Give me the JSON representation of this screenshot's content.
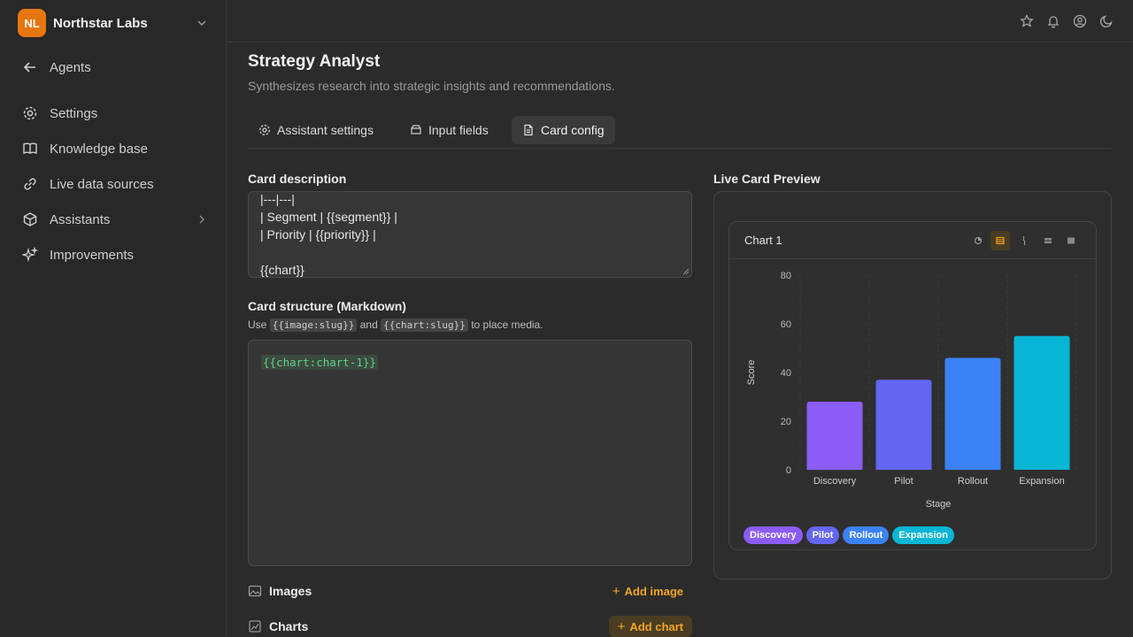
{
  "org": {
    "initials": "NL",
    "name": "Northstar Labs"
  },
  "sidebar": {
    "items": [
      {
        "label": "Agents",
        "icon": "arrow-left-icon"
      },
      {
        "label": "Settings",
        "icon": "gear-icon"
      },
      {
        "label": "Knowledge base",
        "icon": "book-icon"
      },
      {
        "label": "Live data sources",
        "icon": "link-icon"
      },
      {
        "label": "Assistants",
        "icon": "cube-icon"
      },
      {
        "label": "Improvements",
        "icon": "sparkles-icon"
      }
    ]
  },
  "topbar": {
    "icons": [
      "star-icon",
      "bell-icon",
      "user-circle-icon",
      "moon-icon"
    ]
  },
  "page": {
    "title": "Strategy Analyst",
    "subtitle": "Synthesizes research into strategic insights and recommendations."
  },
  "tabs": [
    {
      "label": "Assistant settings",
      "icon": "gear-icon"
    },
    {
      "label": "Input fields",
      "icon": "database-icon"
    },
    {
      "label": "Card config",
      "icon": "file-icon",
      "active": true
    }
  ],
  "card_description": {
    "label": "Card description",
    "lines": [
      "|---|---|",
      "| Segment | {{segment}} |",
      "| Priority | {{priority}} |",
      "",
      "{{chart}}"
    ]
  },
  "card_structure": {
    "label": "Card structure (Markdown)",
    "hint_prefix": "Use",
    "hint_code1": "{{image:slug}}",
    "hint_mid": "and",
    "hint_code2": "{{chart:slug}}",
    "hint_suffix": "to place media.",
    "content": "{{chart:chart-1}}"
  },
  "images": {
    "label": "Images",
    "add_label": "Add image"
  },
  "charts": {
    "label": "Charts",
    "add_label": "Add chart"
  },
  "preview": {
    "label": "Live Card Preview",
    "card_title": "Chart 1",
    "chart_type_icons": [
      "pie-chart-icon",
      "bar-chart-icon",
      "line-chart-icon",
      "area-chart-icon",
      "table-icon"
    ]
  },
  "chart_data": {
    "type": "bar",
    "categories": [
      "Discovery",
      "Pilot",
      "Rollout",
      "Expansion"
    ],
    "values": [
      28,
      37,
      46,
      55
    ],
    "colors": [
      "#8b5cf6",
      "#6366f1",
      "#3b82f6",
      "#06b6d4"
    ],
    "xlabel": "Stage",
    "ylabel": "Score",
    "ylim": [
      0,
      80
    ],
    "yticks": [
      0,
      20,
      40,
      60,
      80
    ],
    "grid": true,
    "legend": "bottom"
  }
}
